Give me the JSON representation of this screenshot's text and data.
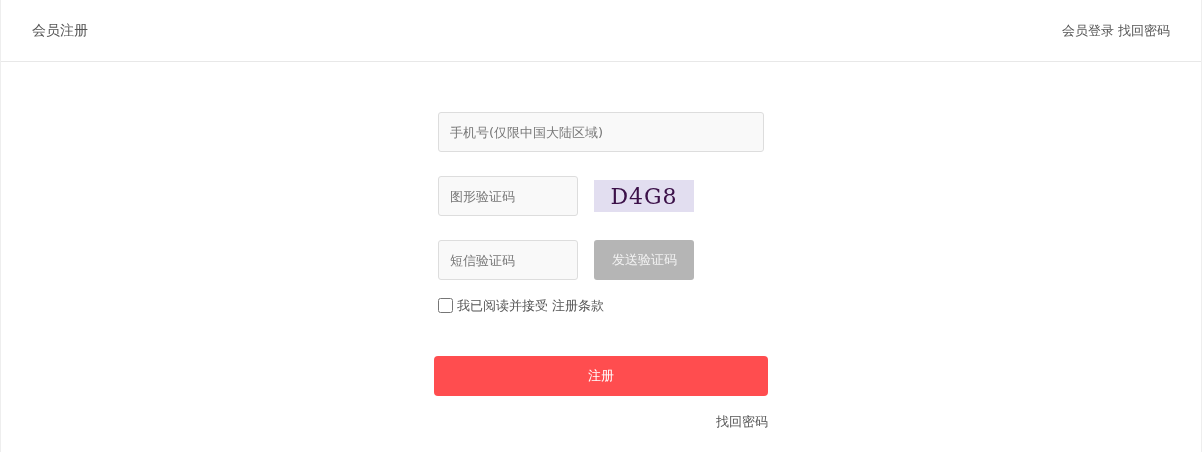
{
  "header": {
    "title": "会员注册",
    "links": [
      "会员登录",
      "找回密码"
    ]
  },
  "form": {
    "phone": {
      "placeholder": "手机号(仅限中国大陆区域)"
    },
    "captcha": {
      "placeholder": "图形验证码",
      "text": "D4G8"
    },
    "sms": {
      "placeholder": "短信验证码",
      "button": "发送验证码",
      "disabled": true
    },
    "agree": {
      "checked": false,
      "label": "我已阅读并接受",
      "terms": "注册条款"
    },
    "submit": "注册",
    "forgot": "找回密码"
  }
}
